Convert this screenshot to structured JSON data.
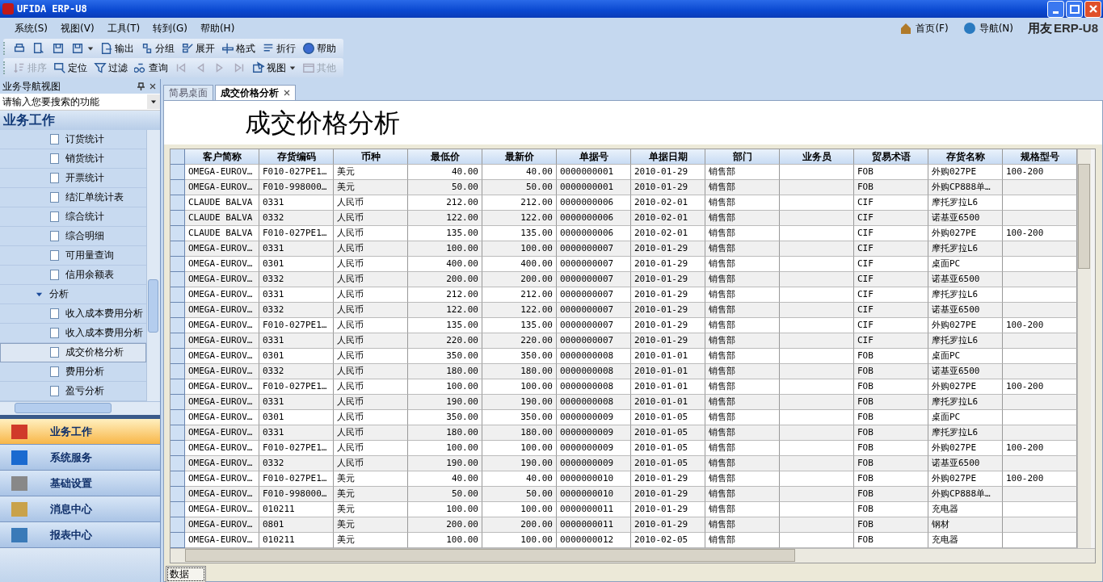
{
  "window": {
    "title": "UFIDA ERP-U8"
  },
  "menu": [
    "系统(S)",
    "视图(V)",
    "工具(T)",
    "转到(G)",
    "帮助(H)"
  ],
  "top_links": [
    {
      "label": "首页(F)",
      "kind": "home"
    },
    {
      "label": "导航(N)",
      "kind": "globe"
    }
  ],
  "brand": {
    "name": "用友",
    "logo": "ERP-U8"
  },
  "toolbar_1": [
    {
      "kind": "print"
    },
    {
      "kind": "preview"
    },
    {
      "kind": "export-disk"
    },
    {
      "kind": "save",
      "caret": true
    },
    {
      "kind": "export",
      "label": "输出"
    },
    {
      "kind": "group",
      "label": "分组"
    },
    {
      "kind": "expand",
      "label": "展开"
    },
    {
      "kind": "format",
      "label": "格式"
    },
    {
      "kind": "wrap",
      "label": "折行"
    },
    {
      "kind": "help",
      "label": "帮助"
    }
  ],
  "toolbar_2": [
    {
      "kind": "sort",
      "label": "排序",
      "disabled": true
    },
    {
      "kind": "locate",
      "label": "定位",
      "disabled": false
    },
    {
      "kind": "filter",
      "label": "过滤",
      "disabled": false
    },
    {
      "kind": "query",
      "label": "查询",
      "disabled": false
    },
    {
      "kind": "first",
      "disabled": true
    },
    {
      "kind": "prev",
      "disabled": true
    },
    {
      "kind": "next",
      "disabled": true
    },
    {
      "kind": "last",
      "disabled": true
    },
    {
      "kind": "view",
      "label": "视图",
      "disabled": false,
      "caret": true
    },
    {
      "kind": "other",
      "label": "其他",
      "disabled": true
    }
  ],
  "nav_panel": {
    "title": "业务导航视图",
    "search": {
      "placeholder": "请输入您要搜索的功能"
    },
    "section": "业务工作",
    "tree": [
      {
        "label": "订货统计",
        "selected": false
      },
      {
        "label": "销货统计",
        "selected": false
      },
      {
        "label": "开票统计",
        "selected": false
      },
      {
        "label": "结汇单统计表",
        "selected": false
      },
      {
        "label": "综合统计",
        "selected": false
      },
      {
        "label": "综合明细",
        "selected": false
      },
      {
        "label": "可用量查询",
        "selected": false
      },
      {
        "label": "信用余额表",
        "selected": false
      },
      {
        "label": "分析",
        "selected": false,
        "expanded": true,
        "children": [
          {
            "label": "收入成本费用分析",
            "selected": false
          },
          {
            "label": "收入成本费用分析",
            "selected": false
          },
          {
            "label": "成交价格分析",
            "selected": true
          },
          {
            "label": "费用分析",
            "selected": false
          },
          {
            "label": "盈亏分析",
            "selected": false
          }
        ]
      }
    ],
    "modules": [
      {
        "label": "业务工作",
        "kind": "chart",
        "selected": true
      },
      {
        "label": "系统服务",
        "kind": "monitor",
        "selected": false
      },
      {
        "label": "基础设置",
        "kind": "gear",
        "selected": false
      },
      {
        "label": "消息中心",
        "kind": "mail",
        "selected": false
      },
      {
        "label": "报表中心",
        "kind": "report",
        "selected": false
      }
    ]
  },
  "tabs": [
    {
      "label": "简易桌面",
      "selected": false,
      "closable": false
    },
    {
      "label": "成交价格分析",
      "selected": true,
      "closable": true
    }
  ],
  "report": {
    "title": "成交价格分析",
    "columns": [
      {
        "label": "客户简称",
        "kind": "text"
      },
      {
        "label": "存货编码",
        "kind": "text"
      },
      {
        "label": "币种",
        "kind": "text"
      },
      {
        "label": "最低价",
        "kind": "number"
      },
      {
        "label": "最新价",
        "kind": "number"
      },
      {
        "label": "单据号",
        "kind": "text"
      },
      {
        "label": "单据日期",
        "kind": "text"
      },
      {
        "label": "部门",
        "kind": "text"
      },
      {
        "label": "业务员",
        "kind": "text"
      },
      {
        "label": "贸易术语",
        "kind": "text"
      },
      {
        "label": "存货名称",
        "kind": "text"
      },
      {
        "label": "规格型号",
        "kind": "text"
      }
    ],
    "rows": [
      [
        "OMEGA-EUROV…",
        "F010-027PE1…",
        "美元",
        "40.00",
        "40.00",
        "0000000001",
        "2010-01-29",
        "销售部",
        null,
        "FOB",
        "外购027PE",
        "100-200"
      ],
      [
        "OMEGA-EUROV…",
        "F010-998000…",
        "美元",
        "50.00",
        "50.00",
        "0000000001",
        "2010-01-29",
        "销售部",
        null,
        "FOB",
        "外购CP888单…",
        null
      ],
      [
        "CLAUDE BALVA",
        "0331",
        "人民币",
        "212.00",
        "212.00",
        "0000000006",
        "2010-02-01",
        "销售部",
        null,
        "CIF",
        "摩托罗拉L6",
        null
      ],
      [
        "CLAUDE BALVA",
        "0332",
        "人民币",
        "122.00",
        "122.00",
        "0000000006",
        "2010-02-01",
        "销售部",
        null,
        "CIF",
        "诺基亚6500",
        null
      ],
      [
        "CLAUDE BALVA",
        "F010-027PE1…",
        "人民币",
        "135.00",
        "135.00",
        "0000000006",
        "2010-02-01",
        "销售部",
        null,
        "CIF",
        "外购027PE",
        "100-200"
      ],
      [
        "OMEGA-EUROV…",
        "0331",
        "人民币",
        "100.00",
        "100.00",
        "0000000007",
        "2010-01-29",
        "销售部",
        null,
        "CIF",
        "摩托罗拉L6",
        null
      ],
      [
        "OMEGA-EUROV…",
        "0301",
        "人民币",
        "400.00",
        "400.00",
        "0000000007",
        "2010-01-29",
        "销售部",
        null,
        "CIF",
        "桌面PC",
        null
      ],
      [
        "OMEGA-EUROV…",
        "0332",
        "人民币",
        "200.00",
        "200.00",
        "0000000007",
        "2010-01-29",
        "销售部",
        null,
        "CIF",
        "诺基亚6500",
        null
      ],
      [
        "OMEGA-EUROV…",
        "0331",
        "人民币",
        "212.00",
        "212.00",
        "0000000007",
        "2010-01-29",
        "销售部",
        null,
        "CIF",
        "摩托罗拉L6",
        null
      ],
      [
        "OMEGA-EUROV…",
        "0332",
        "人民币",
        "122.00",
        "122.00",
        "0000000007",
        "2010-01-29",
        "销售部",
        null,
        "CIF",
        "诺基亚6500",
        null
      ],
      [
        "OMEGA-EUROV…",
        "F010-027PE1…",
        "人民币",
        "135.00",
        "135.00",
        "0000000007",
        "2010-01-29",
        "销售部",
        null,
        "CIF",
        "外购027PE",
        "100-200"
      ],
      [
        "OMEGA-EUROV…",
        "0331",
        "人民币",
        "220.00",
        "220.00",
        "0000000007",
        "2010-01-29",
        "销售部",
        null,
        "CIF",
        "摩托罗拉L6",
        null
      ],
      [
        "OMEGA-EUROV…",
        "0301",
        "人民币",
        "350.00",
        "350.00",
        "0000000008",
        "2010-01-01",
        "销售部",
        null,
        "FOB",
        "桌面PC",
        null
      ],
      [
        "OMEGA-EUROV…",
        "0332",
        "人民币",
        "180.00",
        "180.00",
        "0000000008",
        "2010-01-01",
        "销售部",
        null,
        "FOB",
        "诺基亚6500",
        null
      ],
      [
        "OMEGA-EUROV…",
        "F010-027PE1…",
        "人民币",
        "100.00",
        "100.00",
        "0000000008",
        "2010-01-01",
        "销售部",
        null,
        "FOB",
        "外购027PE",
        "100-200"
      ],
      [
        "OMEGA-EUROV…",
        "0331",
        "人民币",
        "190.00",
        "190.00",
        "0000000008",
        "2010-01-01",
        "销售部",
        null,
        "FOB",
        "摩托罗拉L6",
        null
      ],
      [
        "OMEGA-EUROV…",
        "0301",
        "人民币",
        "350.00",
        "350.00",
        "0000000009",
        "2010-01-05",
        "销售部",
        null,
        "FOB",
        "桌面PC",
        null
      ],
      [
        "OMEGA-EUROV…",
        "0331",
        "人民币",
        "180.00",
        "180.00",
        "0000000009",
        "2010-01-05",
        "销售部",
        null,
        "FOB",
        "摩托罗拉L6",
        null
      ],
      [
        "OMEGA-EUROV…",
        "F010-027PE1…",
        "人民币",
        "100.00",
        "100.00",
        "0000000009",
        "2010-01-05",
        "销售部",
        null,
        "FOB",
        "外购027PE",
        "100-200"
      ],
      [
        "OMEGA-EUROV…",
        "0332",
        "人民币",
        "190.00",
        "190.00",
        "0000000009",
        "2010-01-05",
        "销售部",
        null,
        "FOB",
        "诺基亚6500",
        null
      ],
      [
        "OMEGA-EUROV…",
        "F010-027PE1…",
        "美元",
        "40.00",
        "40.00",
        "0000000010",
        "2010-01-29",
        "销售部",
        null,
        "FOB",
        "外购027PE",
        "100-200"
      ],
      [
        "OMEGA-EUROV…",
        "F010-998000…",
        "美元",
        "50.00",
        "50.00",
        "0000000010",
        "2010-01-29",
        "销售部",
        null,
        "FOB",
        "外购CP888单…",
        null
      ],
      [
        "OMEGA-EUROV…",
        "010211",
        "美元",
        "100.00",
        "100.00",
        "0000000011",
        "2010-01-29",
        "销售部",
        null,
        "FOB",
        "充电器",
        null
      ],
      [
        "OMEGA-EUROV…",
        "0801",
        "美元",
        "200.00",
        "200.00",
        "0000000011",
        "2010-01-29",
        "销售部",
        null,
        "FOB",
        "钢材",
        null
      ],
      [
        "OMEGA-EUROV…",
        "010211",
        "美元",
        "100.00",
        "100.00",
        "0000000012",
        "2010-02-05",
        "销售部",
        null,
        "FOB",
        "充电器",
        null
      ]
    ]
  },
  "sheet_tabs": [
    {
      "label": "数据",
      "selected": true
    }
  ]
}
